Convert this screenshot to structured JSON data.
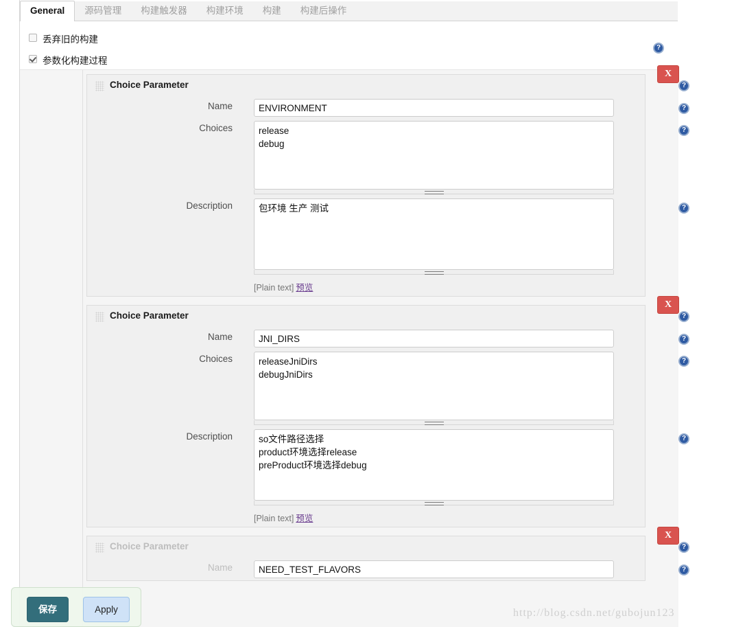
{
  "tabs": [
    {
      "label": "General",
      "active": true
    },
    {
      "label": "源码管理",
      "active": false
    },
    {
      "label": "构建触发器",
      "active": false
    },
    {
      "label": "构建环境",
      "active": false
    },
    {
      "label": "构建",
      "active": false
    },
    {
      "label": "构建后操作",
      "active": false
    }
  ],
  "checkboxes": [
    {
      "label": "丢弃旧的构建",
      "checked": false
    },
    {
      "label": "参数化构建过程",
      "checked": true
    }
  ],
  "labels": {
    "block_title": "Choice Parameter",
    "name": "Name",
    "choices": "Choices",
    "description": "Description",
    "plain_text": "[Plain text]",
    "preview": "预览",
    "delete": "X",
    "help": "?"
  },
  "parameters": [
    {
      "title": "Choice Parameter",
      "name_value": "ENVIRONMENT",
      "choices_value": "release\ndebug",
      "description_value": "包环境 生产 测试"
    },
    {
      "title": "Choice Parameter",
      "name_value": "JNI_DIRS",
      "choices_value": "releaseJniDirs\ndebugJniDirs",
      "description_value": "so文件路径选择\nproduct环境选择release\npreProduct环境选择debug"
    },
    {
      "title": "Choice Parameter",
      "name_value": "NEED_TEST_FLAVORS"
    }
  ],
  "savebar": {
    "save_label": "保存",
    "apply_label": "Apply"
  },
  "watermark": "http://blog.csdn.net/gubojun123",
  "colors": {
    "delete_red": "#d9534f",
    "save_teal": "#336e7b",
    "apply_blue": "#cfe2f7",
    "help_blue": "#2f5ba3",
    "link_purple": "#6a3d8f",
    "panel_gray": "#f0f0f0"
  }
}
